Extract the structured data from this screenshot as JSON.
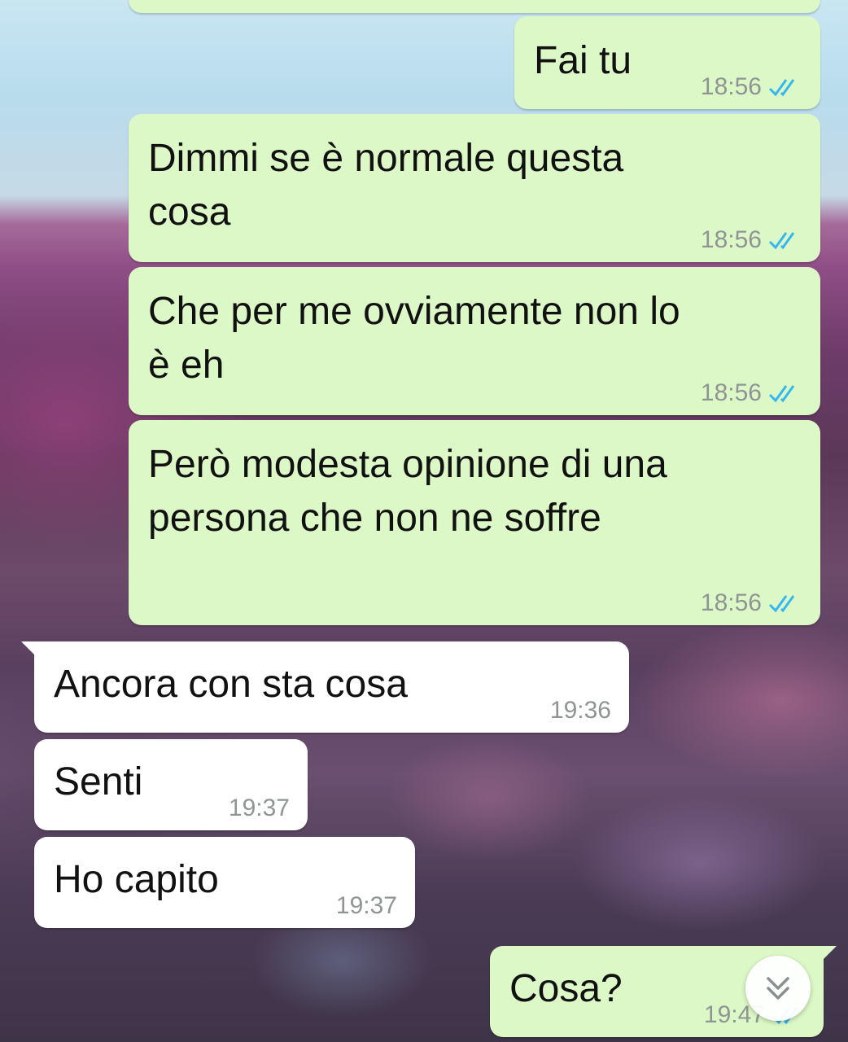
{
  "messages": [
    {
      "text": "",
      "time": "",
      "dir": "out",
      "ticks": "none",
      "read": false
    },
    {
      "text": "Fai tu",
      "time": "18:56",
      "dir": "out",
      "ticks": "double",
      "read": true
    },
    {
      "text": "Dimmi se è normale questa\ncosa",
      "time": "18:56",
      "dir": "out",
      "ticks": "double",
      "read": true
    },
    {
      "text": "Che per me ovviamente non lo\nè eh",
      "time": "18:56",
      "dir": "out",
      "ticks": "double",
      "read": true
    },
    {
      "text": "Però modesta opinione di una\npersona che non ne soffre",
      "time": "18:56",
      "dir": "out",
      "ticks": "double",
      "read": true
    },
    {
      "text": "Ancora con sta cosa",
      "time": "19:36",
      "dir": "in"
    },
    {
      "text": "Senti",
      "time": "19:37",
      "dir": "in"
    },
    {
      "text": "Ho capito",
      "time": "19:37",
      "dir": "in"
    },
    {
      "text": "Cosa?",
      "time": "19:47",
      "dir": "out",
      "ticks": "double",
      "read": true
    }
  ],
  "colors": {
    "outgoing_bubble": "#dcf8c6",
    "incoming_bubble": "#ffffff",
    "read_ticks": "#34b7f1",
    "timestamp": "#8f9495"
  },
  "scroll_button": {
    "icon": "double-chevron-down-icon"
  }
}
